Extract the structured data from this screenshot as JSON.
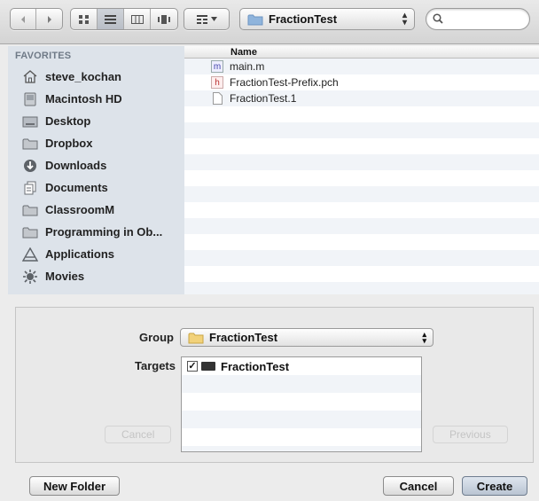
{
  "toolbar": {
    "path_folder": "FractionTest",
    "search_placeholder": ""
  },
  "sidebar": {
    "section": "FAVORITES",
    "items": [
      {
        "label": "steve_kochan",
        "icon": "home-icon"
      },
      {
        "label": "Macintosh HD",
        "icon": "hard-drive-icon"
      },
      {
        "label": "Desktop",
        "icon": "desktop-folder-icon"
      },
      {
        "label": "Dropbox",
        "icon": "folder-icon"
      },
      {
        "label": "Downloads",
        "icon": "downloads-icon"
      },
      {
        "label": "Documents",
        "icon": "documents-icon"
      },
      {
        "label": "ClassroomM",
        "icon": "folder-icon"
      },
      {
        "label": "Programming in Ob...",
        "icon": "folder-icon"
      },
      {
        "label": "Applications",
        "icon": "applications-icon"
      },
      {
        "label": "Movies",
        "icon": "movies-icon"
      }
    ]
  },
  "filelist": {
    "column_header": "Name",
    "files": [
      {
        "name": "main.m",
        "icon": "m-file-icon"
      },
      {
        "name": "FractionTest-Prefix.pch",
        "icon": "h-file-icon"
      },
      {
        "name": "FractionTest.1",
        "icon": "document-icon"
      }
    ]
  },
  "options": {
    "group_label": "Group",
    "group_value": "FractionTest",
    "targets_label": "Targets",
    "targets": [
      {
        "name": "FractionTest",
        "checked": true
      }
    ],
    "ghost_cancel": "Cancel",
    "ghost_previous": "Previous"
  },
  "buttons": {
    "new_folder": "New Folder",
    "cancel": "Cancel",
    "create": "Create"
  },
  "colors": {
    "sidebar_bg": "#dde3ea",
    "folder": "#8fb4dc",
    "accent_button": "#b9c4d2"
  }
}
